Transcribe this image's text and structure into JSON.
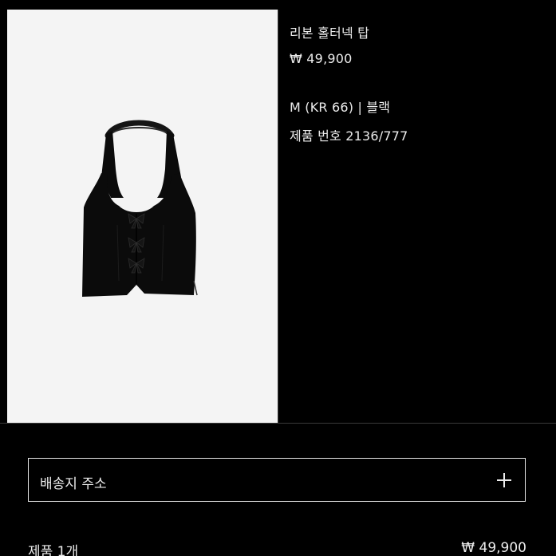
{
  "product": {
    "name": "리본 홀터넥 탑",
    "price": "₩ 49,900",
    "variant": "M (KR 66) | 블랙",
    "product_number": "제품 번호 2136/777",
    "image_icon": "black-halter-vest-image"
  },
  "shipping": {
    "address_label": "배송지 주소",
    "expand_icon": "plus-icon"
  },
  "summary": {
    "items_label": "제품 1개",
    "total": "₩ 49,900"
  },
  "colors": {
    "background": "#000000",
    "text": "#ececec",
    "image_bg": "#f4f4f4",
    "garment": "#0b0b0b"
  }
}
